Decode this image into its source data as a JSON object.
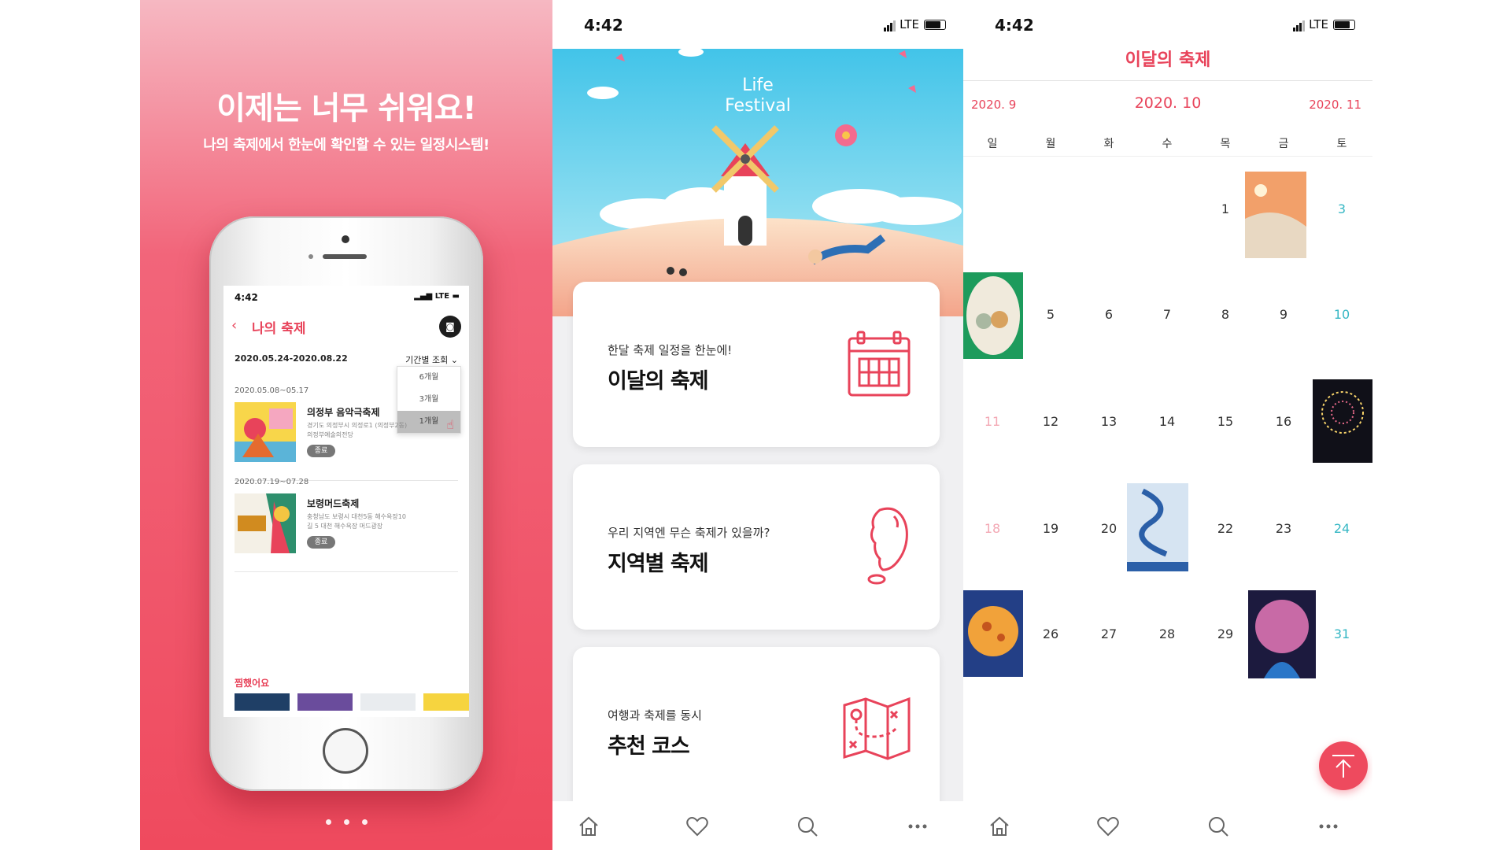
{
  "promo": {
    "headline": "이제는 너무 쉬워요!",
    "subline": "나의 축제에서 한눈에 확인할 수 있는 일정시스템!"
  },
  "phone_screen": {
    "time": "4:42",
    "network": "LTE",
    "title": "나의 축제",
    "date_range": "2020.05.24-2020.08.22",
    "filter_label": "기간별 조회",
    "filter_options": [
      "6개월",
      "3개월",
      "1개월"
    ],
    "items": [
      {
        "date": "2020.05.08~05.17",
        "name": "의정부 음악극축제",
        "address": "경기도 의정부시 의정로1 (의정부2동) 의정부예술의전당",
        "status": "종료"
      },
      {
        "date": "2020.07.19~07.28",
        "name": "보령머드축제",
        "address": "충청남도 보령시 대천5동 해수욕장10길 5 대천 해수욕장 머드광장",
        "status": "종료"
      }
    ],
    "favorites_label": "찜했어요"
  },
  "main": {
    "time": "4:42",
    "network": "LTE",
    "hero_text": [
      "Life",
      "Festival"
    ],
    "cards": [
      {
        "subtitle": "한달 축제 일정을 한눈에!",
        "title": "이달의 축제",
        "icon": "calendar-icon"
      },
      {
        "subtitle": "우리 지역엔 무슨 축제가 있을까?",
        "title": "지역별 축제",
        "icon": "korea-map-icon"
      },
      {
        "subtitle": "여행과 축제를 동시",
        "title": "추천 코스",
        "icon": "route-map-icon"
      }
    ],
    "tabs": [
      "home-icon",
      "heart-icon",
      "search-icon",
      "more-icon"
    ]
  },
  "calendar": {
    "time": "4:42",
    "network": "LTE",
    "title": "이달의 축제",
    "prev_month": "2020. 9",
    "current_month": "2020. 10",
    "next_month": "2020. 11",
    "weekdays": [
      "일",
      "월",
      "화",
      "수",
      "목",
      "금",
      "토"
    ],
    "days": [
      "1",
      "3",
      "5",
      "6",
      "7",
      "8",
      "9",
      "10",
      "11",
      "12",
      "13",
      "14",
      "15",
      "16",
      "18",
      "19",
      "20",
      "22",
      "23",
      "24",
      "26",
      "27",
      "28",
      "29",
      "31"
    ],
    "accent": "#e8435a",
    "saturday_color": "#36b7c4"
  }
}
